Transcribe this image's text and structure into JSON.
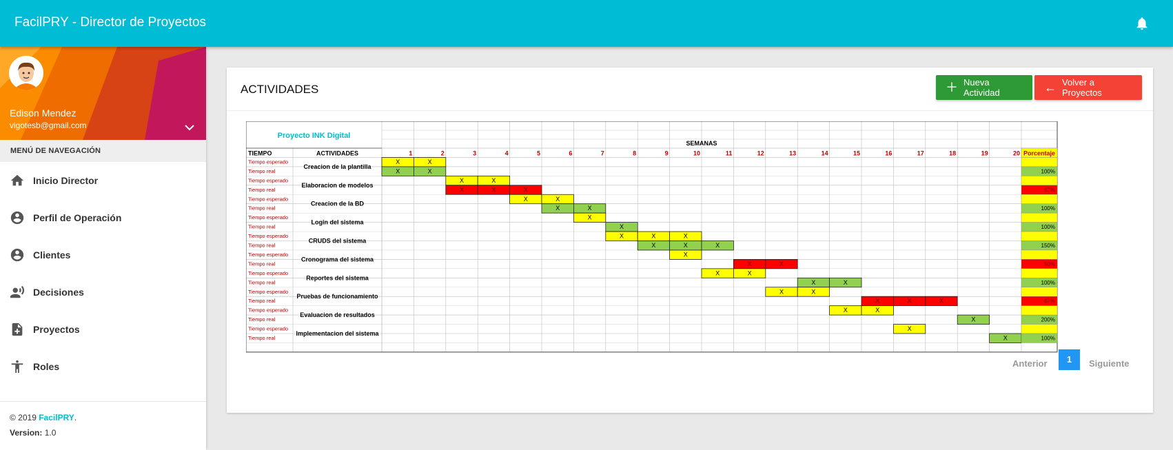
{
  "app": {
    "title": "FacilPRY - Director de Proyectos"
  },
  "user": {
    "name": "Edison Mendez",
    "email": "vigotesb@gmail.com"
  },
  "nav": {
    "heading": "MENÚ DE NAVEGACIÓN",
    "items": [
      {
        "label": "Inicio Director",
        "icon": "home-icon"
      },
      {
        "label": "Perfil de Operación",
        "icon": "account-circle-icon"
      },
      {
        "label": "Clientes",
        "icon": "account-circle-icon"
      },
      {
        "label": "Decisiones",
        "icon": "record-voice-icon"
      },
      {
        "label": "Proyectos",
        "icon": "note-add-icon"
      },
      {
        "label": "Roles",
        "icon": "accessibility-icon"
      }
    ]
  },
  "footer": {
    "copyright_prefix": "© 2019",
    "brand": "FacilPRY",
    "dot": ".",
    "version_label": "Version:",
    "version_value": "1.0"
  },
  "card": {
    "title": "ACTIVIDADES",
    "new_button": "Nueva Actividad",
    "back_button": "Volver a Proyectos"
  },
  "pagination": {
    "prev": "Anterior",
    "current": "1",
    "next": "Siguiente"
  },
  "colors": {
    "primary": "#00bcd4",
    "green_button": "#2e9a36",
    "red_button": "#f44336",
    "yellow": "#ffff00",
    "green_cell": "#92d050",
    "red_cell": "#ff0000",
    "label_red": "#c00000"
  },
  "gantt": {
    "project": "Proyecto INK Digital",
    "weeks_label": "SEMANAS",
    "header_time": "TIEMPO",
    "header_activities": "ACTIVIDADES",
    "header_percent": "Porcentaje",
    "weeks": [
      "1",
      "2",
      "3",
      "4",
      "5",
      "6",
      "7",
      "8",
      "9",
      "10",
      "11",
      "12",
      "13",
      "14",
      "15",
      "16",
      "17",
      "18",
      "19",
      "20"
    ],
    "label_expected": "Tiempo esperado",
    "label_real": "Tiempo real",
    "mark": "X",
    "activities": [
      {
        "name": "Creacion de la plantilla",
        "expected": [
          1,
          2
        ],
        "real": [
          1,
          2
        ],
        "real_color": "green",
        "percent": "100%"
      },
      {
        "name": "Elaboracion de modelos",
        "expected": [
          3,
          4
        ],
        "real": [
          3,
          4,
          5
        ],
        "real_color": "red",
        "percent": "67%"
      },
      {
        "name": "Creacion de la BD",
        "expected": [
          5,
          6
        ],
        "real": [
          6,
          7
        ],
        "real_color": "green",
        "percent": "100%"
      },
      {
        "name": "Login del sistema",
        "expected": [
          7
        ],
        "real": [
          8
        ],
        "real_color": "green",
        "percent": "100%"
      },
      {
        "name": "CRUDS del sistema",
        "expected": [
          8,
          9,
          10
        ],
        "real": [
          9,
          10,
          11
        ],
        "real_color": "green",
        "percent": "150%"
      },
      {
        "name": "Cronograma del sistema",
        "expected": [
          10
        ],
        "real": [
          12,
          13
        ],
        "real_color": "red",
        "percent": "50%"
      },
      {
        "name": "Reportes del sistema",
        "expected": [
          11,
          12
        ],
        "real": [
          14,
          15
        ],
        "real_color": "green",
        "percent": "100%"
      },
      {
        "name": "Pruebas de funcionamiento",
        "expected": [
          13,
          14
        ],
        "real": [
          16,
          17,
          18
        ],
        "real_color": "red",
        "percent": "67%"
      },
      {
        "name": "Evaluacion de resultados",
        "expected": [
          15,
          16
        ],
        "real": [
          19
        ],
        "real_color": "green",
        "percent": "200%"
      },
      {
        "name": "Implementacion del sistema",
        "expected": [
          17
        ],
        "real": [
          20
        ],
        "real_color": "green",
        "percent": "100%"
      }
    ]
  }
}
